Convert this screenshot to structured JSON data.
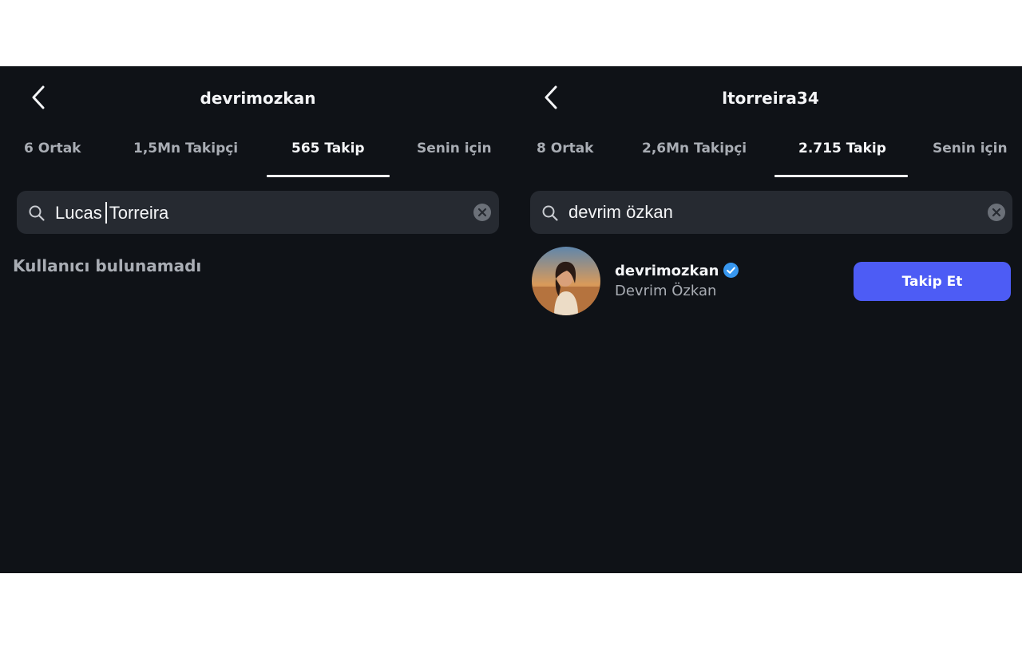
{
  "left_panel": {
    "title": "devrimozkan",
    "tabs": [
      {
        "label": "6 Ortak",
        "active": false
      },
      {
        "label": "1,5Mn Takipçi",
        "active": false
      },
      {
        "label": "565 Takip",
        "active": true
      },
      {
        "label": "Senin için",
        "active": false
      }
    ],
    "search": {
      "before_cursor": "Lucas",
      "after_cursor": "Torreira"
    },
    "empty_message": "Kullanıcı bulunamadı"
  },
  "right_panel": {
    "title": "ltorreira34",
    "tabs": [
      {
        "label": "8 Ortak",
        "active": false
      },
      {
        "label": "2,6Mn Takipçi",
        "active": false
      },
      {
        "label": "2.715 Takip",
        "active": true
      },
      {
        "label": "Senin için",
        "active": false
      }
    ],
    "search": {
      "value": "devrim özkan"
    },
    "result": {
      "username": "devrimozkan",
      "full_name": "Devrim Özkan",
      "verified": true,
      "follow_label": "Takip Et"
    }
  },
  "colors": {
    "background": "#0f1217",
    "search_field": "#262a31",
    "primary_text": "#f4f5f7",
    "secondary_text": "#a9adb4",
    "follow_button": "#4d5cf5",
    "verified_badge": "#3797f0"
  },
  "icons": {
    "back": "chevron-left-icon",
    "search": "search-icon",
    "clear": "clear-circle-icon",
    "verified": "verified-badge-icon"
  }
}
